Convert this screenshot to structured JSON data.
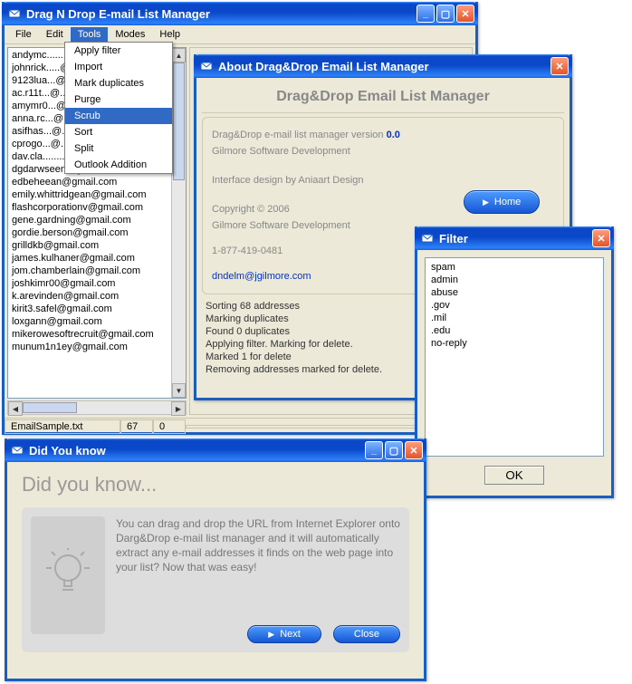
{
  "main": {
    "title": "Drag N Drop E-mail List Manager",
    "menus": {
      "file": "File",
      "edit": "Edit",
      "tools": "Tools",
      "modes": "Modes",
      "help": "Help"
    },
    "tools_menu": [
      "Apply filter",
      "Import",
      "Mark duplicates",
      "Purge",
      "Scrub",
      "Sort",
      "Split",
      "Outlook Addition"
    ],
    "tools_menu_highlight_index": 4,
    "emails": [
      "andymc........@.............",
      "johnrick.....@.............",
      "9123lua...@.............",
      "ac.r11t...@.............",
      "amymr0...@.............",
      "anna.rc...@.............",
      "asifhas...@.............",
      "cprogo...@.............",
      "dav.cla................@...........",
      "dgdarwseen@gmail.com",
      "edbeheean@gmail.com",
      "emily.whittridgean@gmail.com",
      "flashcorporationv@gmail.com",
      "gene.gardning@gmail.com",
      "gordie.berson@gmail.com",
      "grilldkb@gmail.com",
      "james.kulhaner@gmail.com",
      "jom.chamberlain@gmail.com",
      "joshkimr00@gmail.com",
      "k.arevinden@gmail.com",
      "kirit3.safel@gmail.com",
      "loxgann@gmail.com",
      "mikerowesoftrecruit@gmail.com",
      "munum1n1ey@gmail.com"
    ],
    "status": {
      "file": "EmailSample.txt",
      "count": "67",
      "other": "0"
    }
  },
  "about": {
    "title": "About Drag&Drop Email List Manager",
    "header": "Drag&Drop Email List Manager",
    "line1": "Drag&Drop e-mail list manager version ",
    "version": "0.0",
    "line2": "Gilmore Software Development",
    "line3": "Interface design by Aniaart Design",
    "home_btn": "Home",
    "copyright": "Copyright © 2006",
    "company": "Gilmore Software Development",
    "phone": "1-877-419-0481",
    "email": "dndelm@jgilmore.com",
    "log": [
      "Sorting 68 addresses",
      "Marking duplicates",
      "Found 0 duplicates",
      "Applying filter. Marking for delete.",
      "Marked 1 for delete",
      "Removing addresses marked for delete."
    ]
  },
  "filter": {
    "title": "Filter",
    "items": [
      "spam",
      "admin",
      "abuse",
      ".gov",
      ".mil",
      ".edu",
      "no-reply"
    ],
    "ok": "OK"
  },
  "dyk": {
    "title": "Did You know",
    "heading": "Did you know...",
    "text": "You can drag and drop the URL from Internet Explorer onto Darg&Drop e-mail list manager and it will automatically extract any e-mail addresses it finds on the web page into your list? Now that was easy!",
    "next": "Next",
    "close": "Close"
  }
}
